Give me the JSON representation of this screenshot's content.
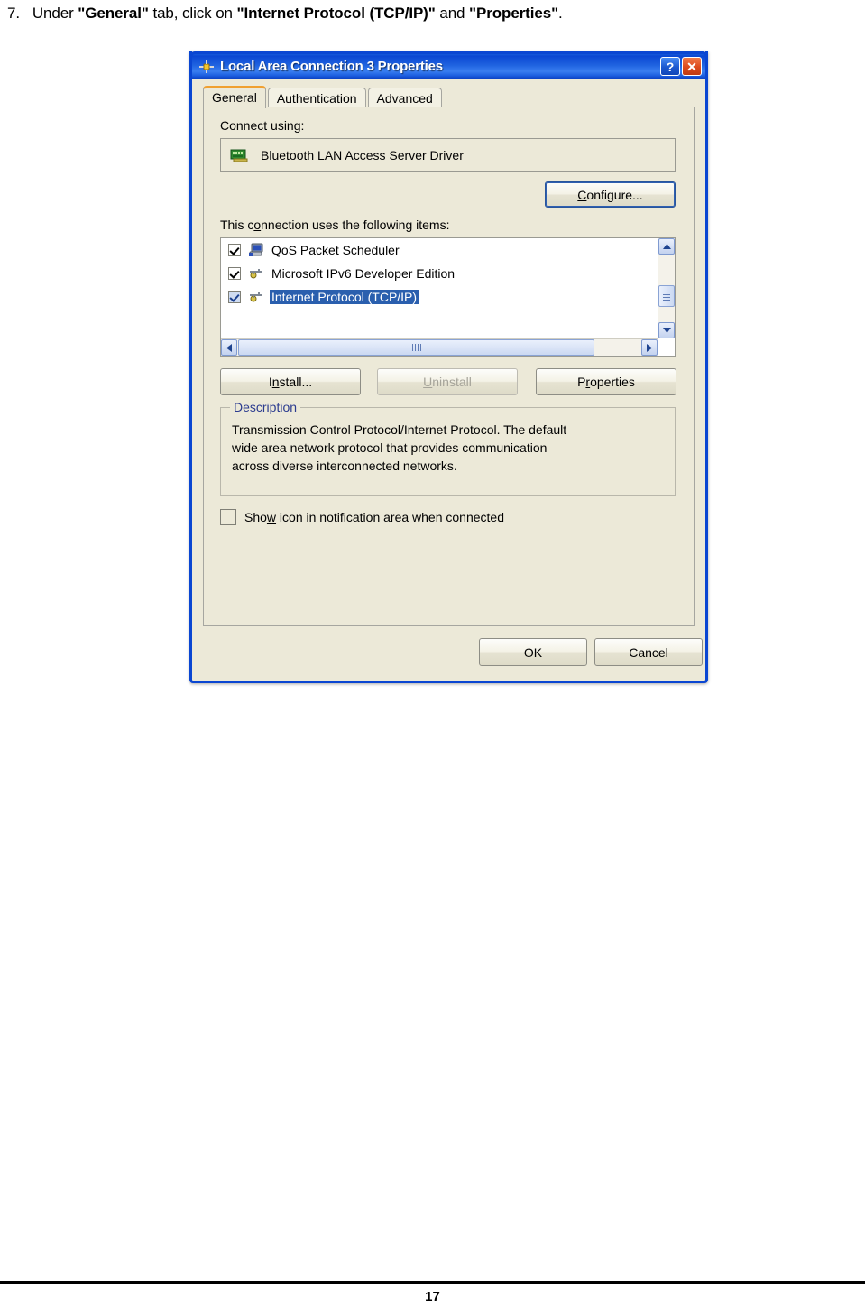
{
  "instruction": {
    "number": "7.",
    "p1": "Under ",
    "b1": "\"General\"",
    "p2": " tab, click on ",
    "b2": "\"Internet Protocol (TCP/IP)\"",
    "p3": " and ",
    "b3": "\"Properties\"",
    "p4": "."
  },
  "dialog": {
    "title": "Local Area Connection 3 Properties",
    "title_icon": "network-connection-icon",
    "help_button": "?",
    "close_button": "✕",
    "tabs": [
      {
        "label": "General",
        "active": true
      },
      {
        "label": "Authentication",
        "active": false
      },
      {
        "label": "Advanced",
        "active": false
      }
    ],
    "connect_using": {
      "label": "Connect using:",
      "adapter": "Bluetooth LAN Access Server Driver",
      "adapter_icon": "network-adapter-icon"
    },
    "configure_button": "Configure...",
    "items_label": "This connection uses the following items:",
    "items": [
      {
        "label": "QoS Packet Scheduler",
        "checked": true,
        "selected": false,
        "icon": "computer-icon"
      },
      {
        "label": "Microsoft IPv6 Developer Edition",
        "checked": true,
        "selected": false,
        "icon": "protocol-icon"
      },
      {
        "label": "Internet Protocol (TCP/IP)",
        "checked": true,
        "selected": true,
        "icon": "protocol-icon"
      }
    ],
    "scroll": {
      "up_arrow": "▲",
      "down_arrow": "▼",
      "left_arrow": "◀",
      "right_arrow": "▶"
    },
    "install_button": "Install...",
    "uninstall_button": "Uninstall",
    "properties_button": "Properties",
    "description": {
      "title": "Description",
      "line1": "Transmission Control Protocol/Internet Protocol. The default",
      "line2": "wide area network protocol that provides communication",
      "line3": "across diverse interconnected networks."
    },
    "show_icon_checkbox": {
      "label": "Show icon in notification area when connected",
      "checked": false
    },
    "ok_button": "OK",
    "cancel_button": "Cancel"
  },
  "footer": {
    "page_number": "17"
  },
  "colors": {
    "titlebar_blue": "#0a46d2",
    "dialog_face": "#ece9d8",
    "selection_blue": "#2a5fae",
    "active_tab_accent": "#f0a030",
    "close_red": "#dc4a1c",
    "group_title_blue": "#2b3b8f"
  }
}
